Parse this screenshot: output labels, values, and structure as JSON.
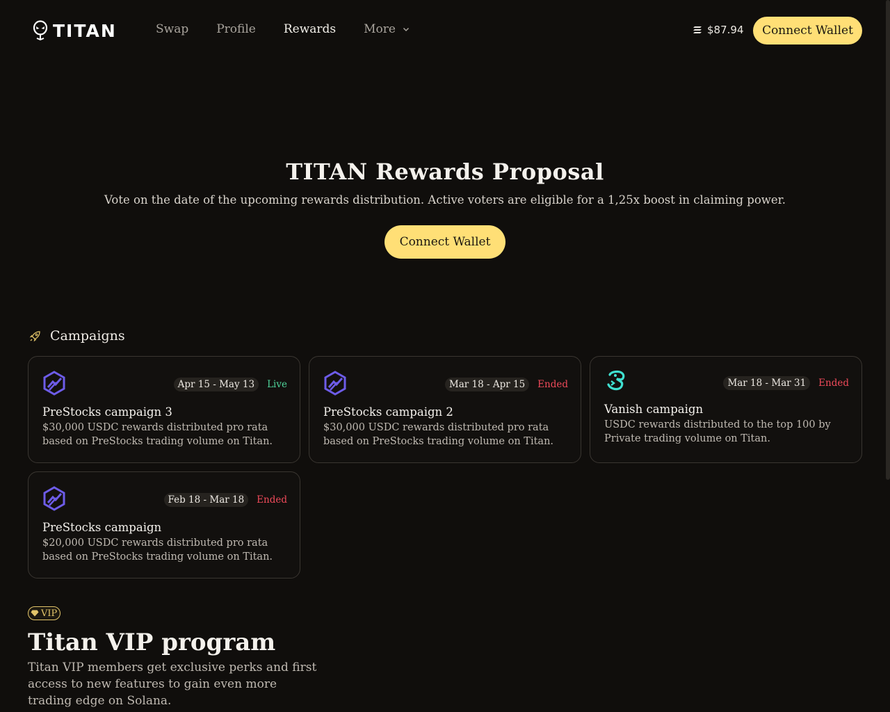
{
  "header": {
    "logo_text": "TITAN",
    "nav": [
      {
        "label": "Swap"
      },
      {
        "label": "Profile"
      },
      {
        "label": "Rewards"
      },
      {
        "label": "More"
      }
    ],
    "balance": "$87.94",
    "connect_label": "Connect Wallet"
  },
  "hero": {
    "title": "TITAN Rewards Proposal",
    "subtitle": "Vote on the date of the upcoming rewards distribution. Active voters are eligible for a 1,25x boost in claiming power.",
    "connect_label": "Connect Wallet"
  },
  "campaigns": {
    "title": "Campaigns",
    "items": [
      {
        "title": "PreStocks campaign 3",
        "dates": "Apr 15 - May 13",
        "status": "Live",
        "description": "$30,000 USDC rewards distributed pro rata based on PreStocks trading volume on Titan.",
        "logo": "prestocks-icon"
      },
      {
        "title": "PreStocks campaign 2",
        "dates": "Mar 18 - Apr 15",
        "status": "Ended",
        "description": "$30,000 USDC rewards distributed pro rata based on PreStocks trading volume on Titan.",
        "logo": "prestocks-icon"
      },
      {
        "title": "Vanish campaign",
        "dates": "Mar 18 - Mar 31",
        "status": "Ended",
        "description": "USDC rewards distributed to the top 100 by Private trading volume on Titan.",
        "logo": "vanish-icon"
      },
      {
        "title": "PreStocks campaign",
        "dates": "Feb 18 - Mar 18",
        "status": "Ended",
        "description": "$20,000 USDC rewards distributed pro rata based on PreStocks trading volume on Titan.",
        "logo": "prestocks-icon"
      }
    ]
  },
  "vip": {
    "badge": "VIP",
    "title": "Titan VIP program",
    "description": "Titan VIP members get exclusive perks and first access to new features to gain even more trading edge on Solana."
  },
  "colors": {
    "background": "#100e0c",
    "accent": "#ffdf76",
    "live": "#4fd39a",
    "ended": "#ef4a5a",
    "prestocks": "#6d5ce8",
    "vanish": "#3fe0d0"
  }
}
